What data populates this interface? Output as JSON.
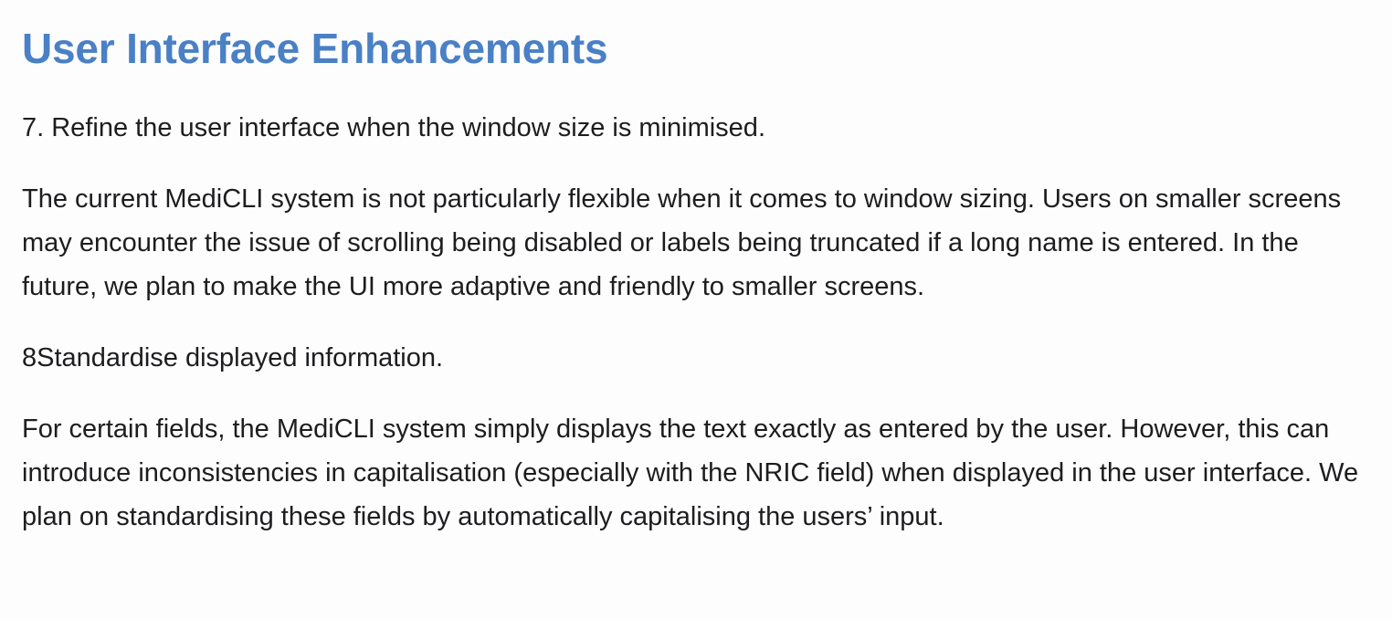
{
  "document": {
    "heading": "User Interface Enhancements",
    "paragraphs": [
      "7. Refine the user interface when the window size is minimised.",
      "The current MediCLI system is not particularly flexible when it comes to window sizing. Users on smaller screens may encounter the issue of scrolling being disabled or labels being truncated if a long name is entered. In the future, we plan to make the UI more adaptive and friendly to smaller screens.",
      "8Standardise displayed information.",
      "For certain fields, the MediCLI system simply displays the text exactly as entered by the user. However, this can introduce inconsistencies in capitalisation (especially with the NRIC field) when displayed in the user interface. We plan on standardising these fields by automatically capitalising the users’ input."
    ]
  },
  "colors": {
    "heading": "#4a80c5",
    "body_text": "#1d1d1f",
    "background": "#fdfdfe"
  }
}
